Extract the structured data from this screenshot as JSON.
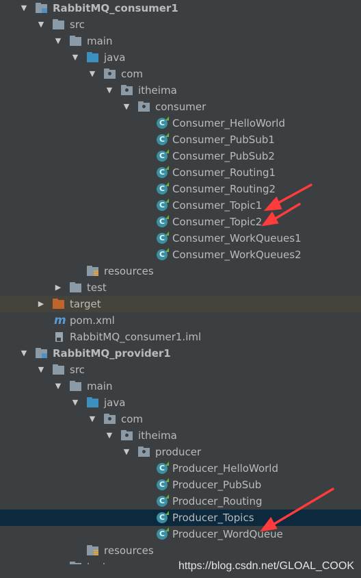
{
  "tree": {
    "consumer_module": "RabbitMQ_consumer1",
    "src": "src",
    "main": "main",
    "java": "java",
    "com": "com",
    "itheima": "itheima",
    "consumer_pkg": "consumer",
    "consumer_classes": [
      "Consumer_HelloWorld",
      "Consumer_PubSub1",
      "Consumer_PubSub2",
      "Consumer_Routing1",
      "Consumer_Routing2",
      "Consumer_Topic1",
      "Consumer_Topic2",
      "Consumer_WorkQueues1",
      "Consumer_WorkQueues2"
    ],
    "resources": "resources",
    "test": "test",
    "target": "target",
    "pom": "pom.xml",
    "consumer_iml": "RabbitMQ_consumer1.iml",
    "provider_module": "RabbitMQ_provider1",
    "producer_pkg": "producer",
    "producer_classes": [
      "Producer_HelloWorld",
      "Producer_PubSub",
      "Producer_Routing",
      "Producer_Topics",
      "Producer_WordQueue"
    ],
    "test_partial": "test",
    "class_icon_letter": "C",
    "maven_icon_letter": "m"
  },
  "watermark": "https://blog.csdn.net/GLOAL_COOK",
  "colors": {
    "background": "#3c3f41",
    "selected_row": "#0d293e",
    "highlight_row": "#45433b",
    "annotation_arrow": "#ff3b3b"
  }
}
